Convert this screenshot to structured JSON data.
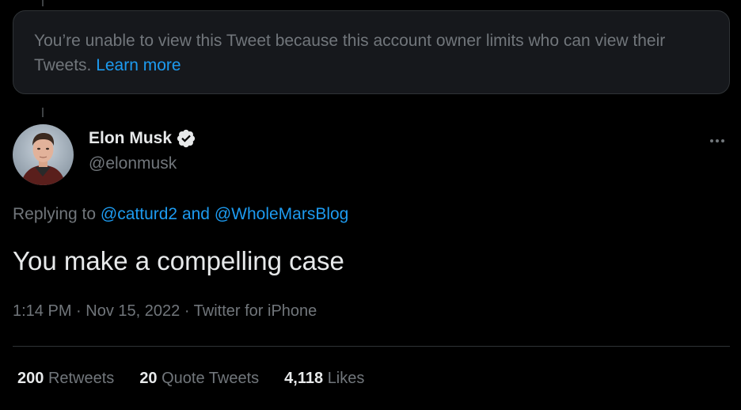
{
  "notice": {
    "text": "You’re unable to view this Tweet because this account owner limits who can view their Tweets. ",
    "link": "Learn more"
  },
  "author": {
    "name": "Elon Musk",
    "handle": "@elonmusk",
    "verified": true
  },
  "reply": {
    "prefix": "Replying to ",
    "mention1": "@catturd2",
    "and": " and ",
    "mention2": "@WholeMarsBlog"
  },
  "tweet": {
    "text": "You make a compelling case",
    "time": "1:14 PM",
    "date": "Nov 15, 2022",
    "source": "Twitter for iPhone"
  },
  "stats": {
    "retweets_count": "200",
    "retweets_label": "Retweets",
    "quotes_count": "20",
    "quotes_label": "Quote Tweets",
    "likes_count": "4,118",
    "likes_label": "Likes"
  },
  "colors": {
    "background": "#000000",
    "link": "#1d9bf0",
    "secondary_text": "#71767b",
    "primary_text": "#e7e9ea"
  }
}
